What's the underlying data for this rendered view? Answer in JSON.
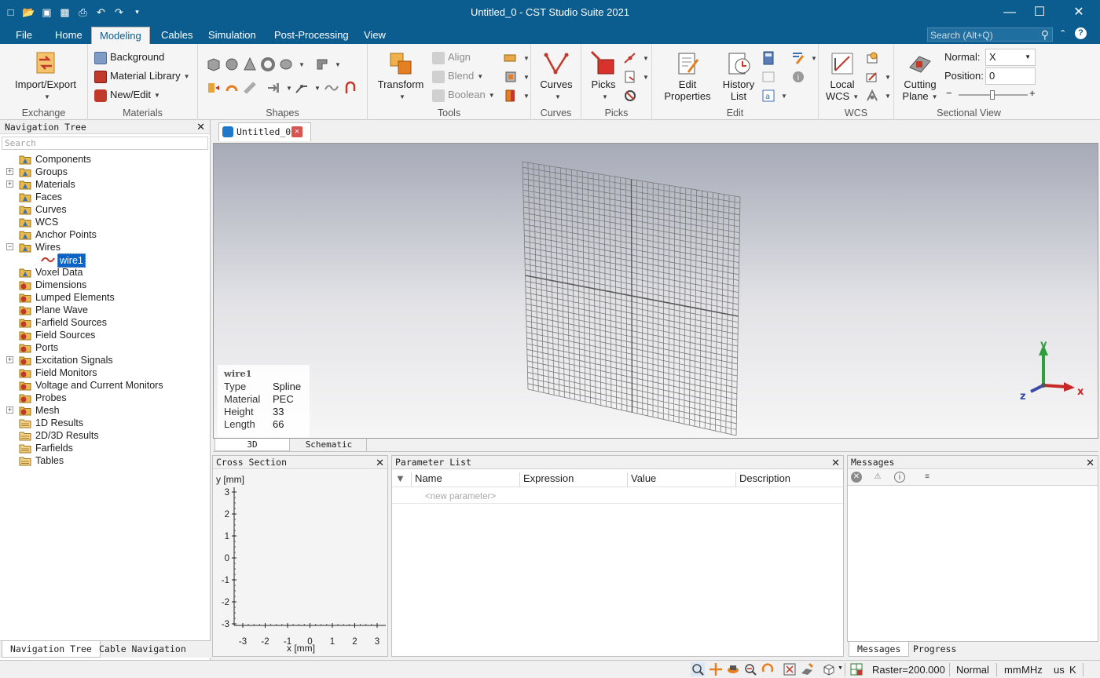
{
  "window": {
    "title": "Untitled_0 - CST Studio Suite 2021",
    "minimize_icon": "minimize-icon",
    "maximize_icon": "maximize-icon",
    "close_icon": "close-icon"
  },
  "quick_access": [
    "new-file-icon",
    "open-folder-icon",
    "save-icon",
    "save-all-icon",
    "print-icon",
    "undo-icon",
    "redo-icon",
    "customize-icon"
  ],
  "menu": {
    "tabs": [
      "File",
      "Home",
      "Modeling",
      "Cables",
      "Simulation",
      "Post-Processing",
      "View"
    ],
    "active": "Modeling",
    "search_placeholder": "Search (Alt+Q)"
  },
  "ribbon": {
    "exchange": {
      "label": "Exchange",
      "import_export": "Import/Export"
    },
    "materials": {
      "label": "Materials",
      "background": "Background",
      "material_library": "Material Library",
      "new_edit": "New/Edit"
    },
    "shapes": {
      "label": "Shapes"
    },
    "tools": {
      "label": "Tools",
      "transform": "Transform",
      "align": "Align",
      "blend": "Blend",
      "boolean": "Boolean"
    },
    "curves": {
      "label": "Curves",
      "curves_btn": "Curves"
    },
    "picks": {
      "label": "Picks",
      "picks_btn": "Picks"
    },
    "edit": {
      "label": "Edit",
      "edit_properties_1": "Edit",
      "edit_properties_2": "Properties",
      "history_list_1": "History",
      "history_list_2": "List"
    },
    "wcs": {
      "label": "WCS",
      "local_wcs_1": "Local",
      "local_wcs_2": "WCS"
    },
    "sectional": {
      "label": "Sectional View",
      "cutting_plane_1": "Cutting",
      "cutting_plane_2": "Plane",
      "normal_label": "Normal:",
      "normal_value": "X",
      "position_label": "Position:",
      "position_value": "0",
      "minus": "−",
      "plus": "+"
    }
  },
  "nav": {
    "title": "Navigation Tree",
    "search_placeholder": "Search",
    "items": [
      {
        "label": "Components",
        "expandable": false,
        "folder": "yellow"
      },
      {
        "label": "Groups",
        "expandable": true,
        "folder": "yellow"
      },
      {
        "label": "Materials",
        "expandable": true,
        "folder": "yellow"
      },
      {
        "label": "Faces",
        "expandable": false,
        "folder": "yellow"
      },
      {
        "label": "Curves",
        "expandable": false,
        "folder": "yellow"
      },
      {
        "label": "WCS",
        "expandable": false,
        "folder": "yellow"
      },
      {
        "label": "Anchor Points",
        "expandable": false,
        "folder": "yellow"
      },
      {
        "label": "Wires",
        "expandable": true,
        "expanded": true,
        "folder": "yellow"
      },
      {
        "label": "wire1",
        "child": true,
        "selected": true
      },
      {
        "label": "Voxel Data",
        "expandable": false,
        "folder": "yellow"
      },
      {
        "label": "Dimensions",
        "expandable": false,
        "folder": "red"
      },
      {
        "label": "Lumped Elements",
        "expandable": false,
        "folder": "red"
      },
      {
        "label": "Plane Wave",
        "expandable": false,
        "folder": "red"
      },
      {
        "label": "Farfield Sources",
        "expandable": false,
        "folder": "red"
      },
      {
        "label": "Field Sources",
        "expandable": false,
        "folder": "red"
      },
      {
        "label": "Ports",
        "expandable": false,
        "folder": "red"
      },
      {
        "label": "Excitation Signals",
        "expandable": true,
        "folder": "red"
      },
      {
        "label": "Field Monitors",
        "expandable": false,
        "folder": "red"
      },
      {
        "label": "Voltage and Current Monitors",
        "expandable": false,
        "folder": "red"
      },
      {
        "label": "Probes",
        "expandable": false,
        "folder": "red"
      },
      {
        "label": "Mesh",
        "expandable": true,
        "folder": "red"
      },
      {
        "label": "1D Results",
        "expandable": false,
        "folder": "result"
      },
      {
        "label": "2D/3D Results",
        "expandable": false,
        "folder": "result"
      },
      {
        "label": "Farfields",
        "expandable": false,
        "folder": "result"
      },
      {
        "label": "Tables",
        "expandable": false,
        "folder": "result"
      }
    ],
    "tabs": [
      "Navigation Tree",
      "Cable Navigation Tree"
    ]
  },
  "document": {
    "tab": "Untitled_0*"
  },
  "viewport": {
    "info": {
      "name": "wire1",
      "rows": [
        {
          "k": "Type",
          "v": "Spline"
        },
        {
          "k": "Material",
          "v": "PEC"
        },
        {
          "k": "Height",
          "v": "33"
        },
        {
          "k": "Length",
          "v": "66"
        }
      ]
    },
    "axes": {
      "x": "x",
      "y": "y",
      "z": "z"
    },
    "tabs": [
      "3D",
      "Schematic"
    ]
  },
  "cross_section": {
    "title": "Cross Section",
    "ylabel": "y [mm]",
    "xlabel": "x [mm]",
    "yticks": [
      "3",
      "2",
      "1",
      "0",
      "-1",
      "-2",
      "-3"
    ],
    "xticks": [
      "-3",
      "-2",
      "-1",
      "0",
      "1",
      "2",
      "3"
    ]
  },
  "parameter_list": {
    "title": "Parameter List",
    "columns": [
      "Name",
      "Expression",
      "Value",
      "Description"
    ],
    "new_parameter": "<new parameter>"
  },
  "messages": {
    "title": "Messages",
    "tabs": [
      "Messages",
      "Progress"
    ]
  },
  "status": {
    "raster": "Raster=200.000",
    "mode": "Normal",
    "units": [
      "mm",
      "MHz",
      "us",
      "K"
    ]
  },
  "colors": {
    "titlebar": "#0b5d8f",
    "accent": "#0b62c7",
    "folder_yellow": "#e9b949",
    "folder_red": "#c0392b"
  }
}
